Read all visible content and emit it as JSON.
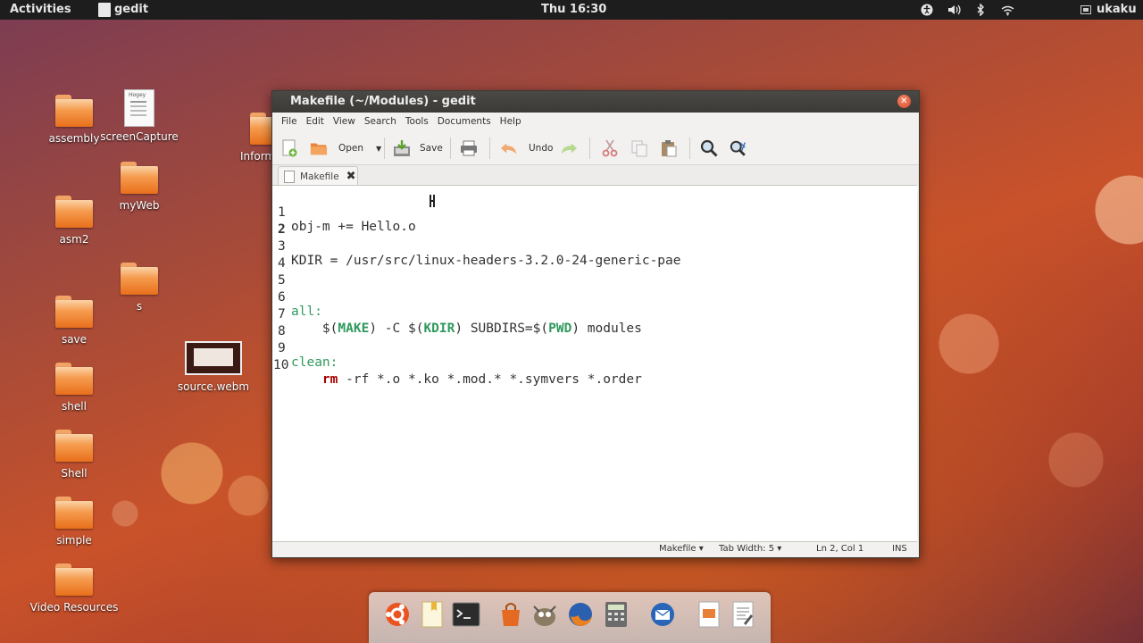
{
  "topbar": {
    "activities": "Activities",
    "app_name": "gedit",
    "clock": "Thu 16:30",
    "user": "ukaku",
    "tray_icons": [
      "accessibility-icon",
      "volume-icon",
      "bluetooth-icon",
      "wifi-icon",
      "user-icon"
    ]
  },
  "desktop": {
    "icons": [
      {
        "label": "assembly"
      },
      {
        "label": "screenCapture"
      },
      {
        "label": "Inform"
      },
      {
        "label": "myWeb"
      },
      {
        "label": "asm2"
      },
      {
        "label": "s"
      },
      {
        "label": "save"
      },
      {
        "label": "source.webm"
      },
      {
        "label": "shell"
      },
      {
        "label": "Shell"
      },
      {
        "label": "simple"
      },
      {
        "label": "Video Resources"
      }
    ],
    "doc_icon_text": "Hogey"
  },
  "window": {
    "title": "Makefile (~/Modules) - gedit",
    "close_glyph": "✕",
    "menu": [
      "File",
      "Edit",
      "View",
      "Search",
      "Tools",
      "Documents",
      "Help"
    ],
    "toolbar": {
      "open_label": "Open",
      "save_label": "Save",
      "undo_label": "Undo"
    },
    "tab": {
      "label": "Makefile",
      "close_glyph": "✖"
    },
    "editor": {
      "line_numbers": [
        "1",
        "2",
        "3",
        "4",
        "5",
        "6",
        "7",
        "8",
        "9",
        "10"
      ],
      "lines": [
        "obj-m += Hello.o",
        "",
        "KDIR = /usr/src/linux-headers-3.2.0-24-generic-pae",
        "",
        "",
        "all:",
        "\t$(MAKE) -C $(KDIR) SUBDIRS=$(PWD) modules",
        "",
        "clean:",
        "\trm -rf *.o *.ko *.mod.* *.symvers *.order"
      ],
      "tokens": {
        "l7_indent": "    ",
        "dollar_open": "$(",
        "make": "MAKE",
        "close": ")",
        "flag_c": " -C ",
        "kdir": "KDIR",
        "subdirs": " SUBDIRS=$(",
        "pwd": "PWD",
        "modules": ") modules",
        "rm": "rm",
        "rm_args": " -rf *.o *.ko *.mod.* *.symvers *.order"
      }
    },
    "statusbar": {
      "language": "Makefile ▾",
      "tab_width": "Tab Width: 5 ▾",
      "position": "Ln 2, Col 1",
      "mode": "INS"
    }
  },
  "dock": {
    "items": [
      "ubuntu-icon",
      "files-icon",
      "terminal-icon",
      "software-center-icon",
      "gimp-icon",
      "firefox-icon",
      "calculator-icon",
      "thunderbird-icon",
      "presentation-icon",
      "text-editor-icon"
    ]
  },
  "colors": {
    "keyword": "#2f9a5e",
    "command": "#a40000",
    "close_button": "#d94a26"
  }
}
